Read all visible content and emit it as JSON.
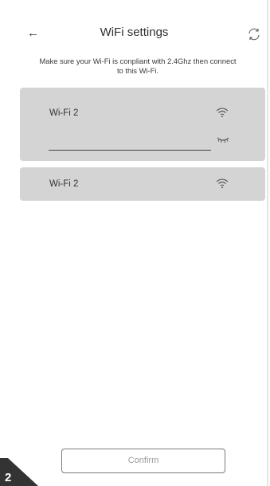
{
  "header": {
    "title": "WiFi settings",
    "back_icon": "arrow-left-icon",
    "refresh_icon": "refresh-icon"
  },
  "hint": "Make sure your Wi-Fi is conpliant with 2.4Ghz then connect to this Wi-Fi.",
  "selected_network": {
    "ssid": "Wi-Fi 2",
    "password_value": "",
    "wifi_icon": "wifi-icon",
    "visibility_icon": "eye-closed-icon"
  },
  "networks": [
    {
      "ssid": "Wi-Fi 2",
      "icon": "wifi-icon"
    }
  ],
  "confirm_label": "Confirm",
  "corner_badge": "2",
  "colors": {
    "card_bg": "#d4d4d4",
    "text": "#333333",
    "badge": "#333333",
    "button_text": "#9a9a9a"
  }
}
